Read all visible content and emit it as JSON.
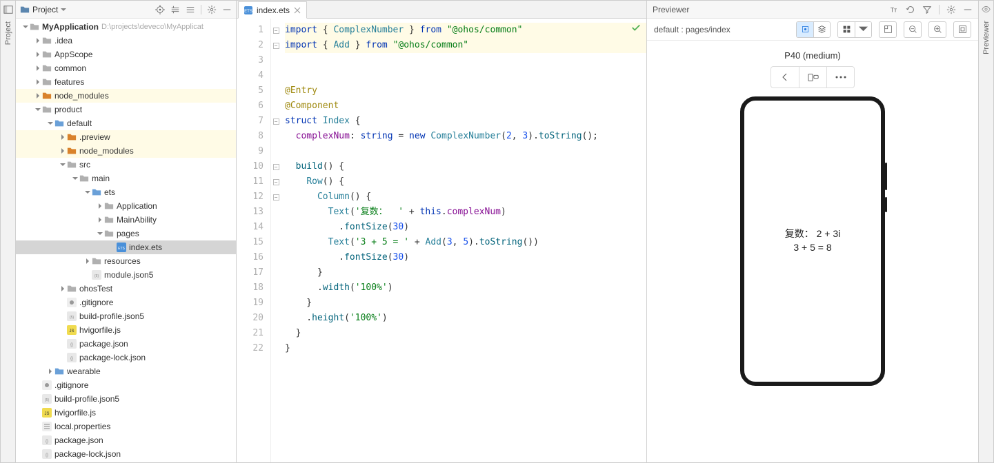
{
  "leftTab": {
    "label": "Project"
  },
  "rightTab": {
    "label": "Previewer"
  },
  "projectPanel": {
    "title": "Project",
    "rootName": "MyApplication",
    "rootPath": "D:\\projects\\deveco\\MyApplicat"
  },
  "tree": [
    {
      "depth": 0,
      "arrow": "down",
      "icon": "folder-open",
      "label": "MyApplication",
      "bold": true,
      "path": "D:\\projects\\deveco\\MyApplicat"
    },
    {
      "depth": 1,
      "arrow": "right",
      "icon": "folder",
      "label": ".idea"
    },
    {
      "depth": 1,
      "arrow": "right",
      "icon": "folder",
      "label": "AppScope"
    },
    {
      "depth": 1,
      "arrow": "right",
      "icon": "folder",
      "label": "common"
    },
    {
      "depth": 1,
      "arrow": "right",
      "icon": "folder",
      "label": "features"
    },
    {
      "depth": 1,
      "arrow": "right",
      "icon": "folder-lib",
      "label": "node_modules",
      "hl": true
    },
    {
      "depth": 1,
      "arrow": "down",
      "icon": "folder",
      "label": "product"
    },
    {
      "depth": 2,
      "arrow": "down",
      "icon": "folder-mod",
      "label": "default"
    },
    {
      "depth": 3,
      "arrow": "right",
      "icon": "folder-lib",
      "label": ".preview",
      "hl": true
    },
    {
      "depth": 3,
      "arrow": "right",
      "icon": "folder-lib",
      "label": "node_modules",
      "hl": true
    },
    {
      "depth": 3,
      "arrow": "down",
      "icon": "folder",
      "label": "src"
    },
    {
      "depth": 4,
      "arrow": "down",
      "icon": "folder",
      "label": "main"
    },
    {
      "depth": 5,
      "arrow": "down",
      "icon": "folder-mod",
      "label": "ets"
    },
    {
      "depth": 6,
      "arrow": "right",
      "icon": "folder",
      "label": "Application"
    },
    {
      "depth": 6,
      "arrow": "right",
      "icon": "folder",
      "label": "MainAbility"
    },
    {
      "depth": 6,
      "arrow": "down",
      "icon": "folder",
      "label": "pages"
    },
    {
      "depth": 7,
      "arrow": "none",
      "icon": "ets",
      "label": "index.ets",
      "selected": true
    },
    {
      "depth": 5,
      "arrow": "right",
      "icon": "folder",
      "label": "resources"
    },
    {
      "depth": 5,
      "arrow": "none",
      "icon": "json5",
      "label": "module.json5"
    },
    {
      "depth": 3,
      "arrow": "right",
      "icon": "folder",
      "label": "ohosTest"
    },
    {
      "depth": 3,
      "arrow": "none",
      "icon": "gitignore",
      "label": ".gitignore"
    },
    {
      "depth": 3,
      "arrow": "none",
      "icon": "json5",
      "label": "build-profile.json5"
    },
    {
      "depth": 3,
      "arrow": "none",
      "icon": "js",
      "label": "hvigorfile.js"
    },
    {
      "depth": 3,
      "arrow": "none",
      "icon": "json",
      "label": "package.json"
    },
    {
      "depth": 3,
      "arrow": "none",
      "icon": "json",
      "label": "package-lock.json"
    },
    {
      "depth": 2,
      "arrow": "right",
      "icon": "folder-mod",
      "label": "wearable"
    },
    {
      "depth": 1,
      "arrow": "none",
      "icon": "gitignore",
      "label": ".gitignore"
    },
    {
      "depth": 1,
      "arrow": "none",
      "icon": "json5",
      "label": "build-profile.json5"
    },
    {
      "depth": 1,
      "arrow": "none",
      "icon": "js",
      "label": "hvigorfile.js"
    },
    {
      "depth": 1,
      "arrow": "none",
      "icon": "props",
      "label": "local.properties"
    },
    {
      "depth": 1,
      "arrow": "none",
      "icon": "json",
      "label": "package.json"
    },
    {
      "depth": 1,
      "arrow": "none",
      "icon": "json",
      "label": "package-lock.json"
    }
  ],
  "editor": {
    "tab": {
      "label": "index.ets"
    },
    "lineCount": 22
  },
  "previewer": {
    "title": "Previewer",
    "path": "default : pages/index",
    "device": "P40 (medium)",
    "screenLine1": "复数：  2 + 3i",
    "screenLine2": "3 + 5 = 8"
  }
}
